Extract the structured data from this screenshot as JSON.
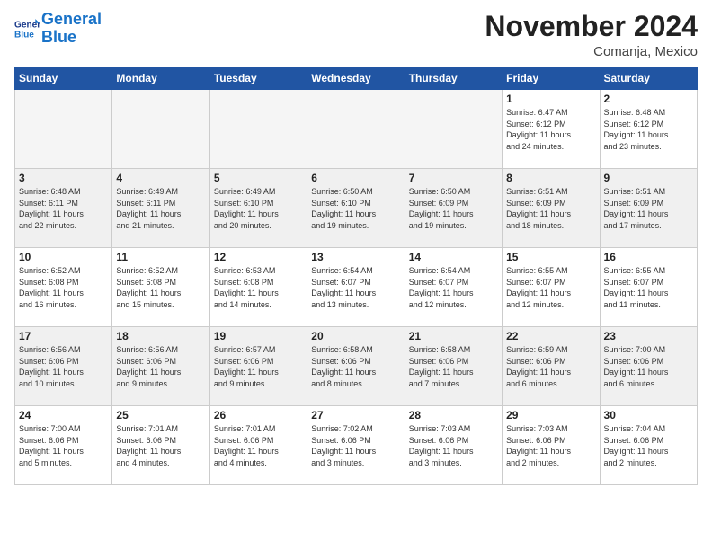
{
  "logo": {
    "text_general": "General",
    "text_blue": "Blue"
  },
  "header": {
    "month": "November 2024",
    "location": "Comanja, Mexico"
  },
  "weekdays": [
    "Sunday",
    "Monday",
    "Tuesday",
    "Wednesday",
    "Thursday",
    "Friday",
    "Saturday"
  ],
  "weeks": [
    [
      {
        "day": "",
        "info": ""
      },
      {
        "day": "",
        "info": ""
      },
      {
        "day": "",
        "info": ""
      },
      {
        "day": "",
        "info": ""
      },
      {
        "day": "",
        "info": ""
      },
      {
        "day": "1",
        "info": "Sunrise: 6:47 AM\nSunset: 6:12 PM\nDaylight: 11 hours\nand 24 minutes."
      },
      {
        "day": "2",
        "info": "Sunrise: 6:48 AM\nSunset: 6:12 PM\nDaylight: 11 hours\nand 23 minutes."
      }
    ],
    [
      {
        "day": "3",
        "info": "Sunrise: 6:48 AM\nSunset: 6:11 PM\nDaylight: 11 hours\nand 22 minutes."
      },
      {
        "day": "4",
        "info": "Sunrise: 6:49 AM\nSunset: 6:11 PM\nDaylight: 11 hours\nand 21 minutes."
      },
      {
        "day": "5",
        "info": "Sunrise: 6:49 AM\nSunset: 6:10 PM\nDaylight: 11 hours\nand 20 minutes."
      },
      {
        "day": "6",
        "info": "Sunrise: 6:50 AM\nSunset: 6:10 PM\nDaylight: 11 hours\nand 19 minutes."
      },
      {
        "day": "7",
        "info": "Sunrise: 6:50 AM\nSunset: 6:09 PM\nDaylight: 11 hours\nand 19 minutes."
      },
      {
        "day": "8",
        "info": "Sunrise: 6:51 AM\nSunset: 6:09 PM\nDaylight: 11 hours\nand 18 minutes."
      },
      {
        "day": "9",
        "info": "Sunrise: 6:51 AM\nSunset: 6:09 PM\nDaylight: 11 hours\nand 17 minutes."
      }
    ],
    [
      {
        "day": "10",
        "info": "Sunrise: 6:52 AM\nSunset: 6:08 PM\nDaylight: 11 hours\nand 16 minutes."
      },
      {
        "day": "11",
        "info": "Sunrise: 6:52 AM\nSunset: 6:08 PM\nDaylight: 11 hours\nand 15 minutes."
      },
      {
        "day": "12",
        "info": "Sunrise: 6:53 AM\nSunset: 6:08 PM\nDaylight: 11 hours\nand 14 minutes."
      },
      {
        "day": "13",
        "info": "Sunrise: 6:54 AM\nSunset: 6:07 PM\nDaylight: 11 hours\nand 13 minutes."
      },
      {
        "day": "14",
        "info": "Sunrise: 6:54 AM\nSunset: 6:07 PM\nDaylight: 11 hours\nand 12 minutes."
      },
      {
        "day": "15",
        "info": "Sunrise: 6:55 AM\nSunset: 6:07 PM\nDaylight: 11 hours\nand 12 minutes."
      },
      {
        "day": "16",
        "info": "Sunrise: 6:55 AM\nSunset: 6:07 PM\nDaylight: 11 hours\nand 11 minutes."
      }
    ],
    [
      {
        "day": "17",
        "info": "Sunrise: 6:56 AM\nSunset: 6:06 PM\nDaylight: 11 hours\nand 10 minutes."
      },
      {
        "day": "18",
        "info": "Sunrise: 6:56 AM\nSunset: 6:06 PM\nDaylight: 11 hours\nand 9 minutes."
      },
      {
        "day": "19",
        "info": "Sunrise: 6:57 AM\nSunset: 6:06 PM\nDaylight: 11 hours\nand 9 minutes."
      },
      {
        "day": "20",
        "info": "Sunrise: 6:58 AM\nSunset: 6:06 PM\nDaylight: 11 hours\nand 8 minutes."
      },
      {
        "day": "21",
        "info": "Sunrise: 6:58 AM\nSunset: 6:06 PM\nDaylight: 11 hours\nand 7 minutes."
      },
      {
        "day": "22",
        "info": "Sunrise: 6:59 AM\nSunset: 6:06 PM\nDaylight: 11 hours\nand 6 minutes."
      },
      {
        "day": "23",
        "info": "Sunrise: 7:00 AM\nSunset: 6:06 PM\nDaylight: 11 hours\nand 6 minutes."
      }
    ],
    [
      {
        "day": "24",
        "info": "Sunrise: 7:00 AM\nSunset: 6:06 PM\nDaylight: 11 hours\nand 5 minutes."
      },
      {
        "day": "25",
        "info": "Sunrise: 7:01 AM\nSunset: 6:06 PM\nDaylight: 11 hours\nand 4 minutes."
      },
      {
        "day": "26",
        "info": "Sunrise: 7:01 AM\nSunset: 6:06 PM\nDaylight: 11 hours\nand 4 minutes."
      },
      {
        "day": "27",
        "info": "Sunrise: 7:02 AM\nSunset: 6:06 PM\nDaylight: 11 hours\nand 3 minutes."
      },
      {
        "day": "28",
        "info": "Sunrise: 7:03 AM\nSunset: 6:06 PM\nDaylight: 11 hours\nand 3 minutes."
      },
      {
        "day": "29",
        "info": "Sunrise: 7:03 AM\nSunset: 6:06 PM\nDaylight: 11 hours\nand 2 minutes."
      },
      {
        "day": "30",
        "info": "Sunrise: 7:04 AM\nSunset: 6:06 PM\nDaylight: 11 hours\nand 2 minutes."
      }
    ]
  ]
}
